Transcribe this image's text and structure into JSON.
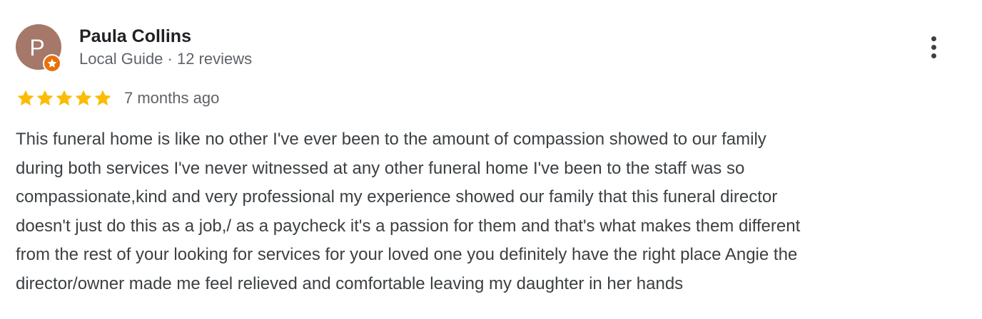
{
  "review": {
    "author": {
      "initial": "P",
      "name": "Paula Collins",
      "meta": "Local Guide · 12 reviews",
      "avatar_color": "#a5786a",
      "badge": "local-guide-star-icon",
      "badge_color": "#e8710a"
    },
    "menu_icon": "more-vertical-icon",
    "rating": {
      "stars": 5,
      "max": 5,
      "star_color": "#fbbc04"
    },
    "date": "7 months ago",
    "text_lines": [
      "This funeral home is like no other I've ever been to the amount of compassion showed to our family",
      "during both services I've never witnessed at any other funeral home I've been to the staff was so",
      "compassionate,kind and very professional my experience showed our family that this funeral director",
      "doesn't just do this as a job,/ as a paycheck it's a passion for them and that's what makes them different",
      "from the rest of your looking for services for your loved one you definitely have the right place Angie the",
      "director/owner made me feel relieved and comfortable leaving my daughter in her hands"
    ]
  }
}
